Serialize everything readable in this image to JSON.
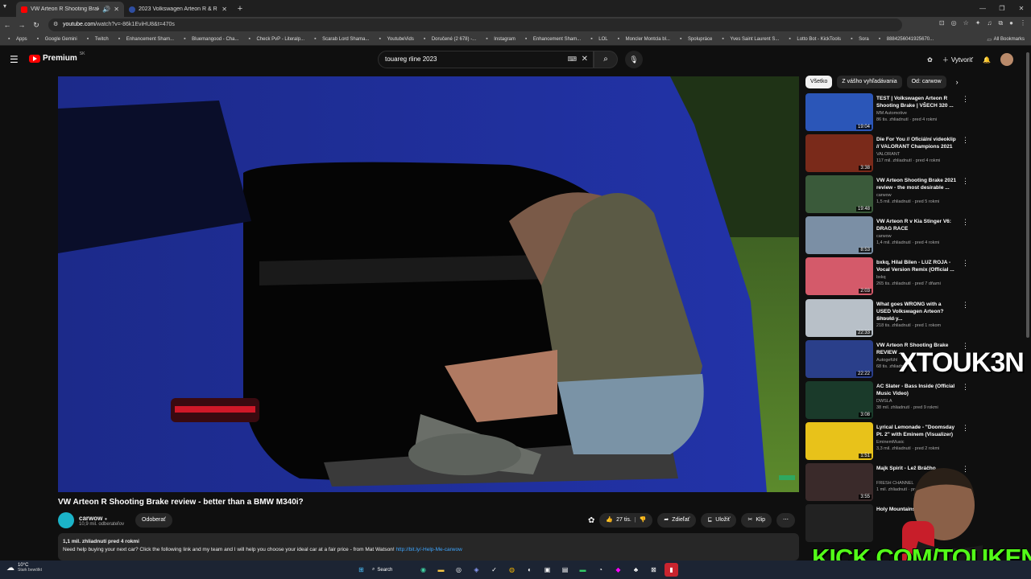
{
  "browser": {
    "tabs": [
      {
        "title": "VW Arteon R Shooting Brak",
        "active": true
      },
      {
        "title": "2023 Volkswagen Arteon R & R",
        "active": false
      }
    ],
    "url_prefix": "youtube.com",
    "url_rest": "/watch?v=-86k1EviHU8&t=470s",
    "bookmarks": [
      "Apps",
      "Google Gemini",
      "Twitch",
      "Enhancement Sham...",
      "Bluemangood - Cha...",
      "Check PvP - Literalp...",
      "Scarab Lord Shama...",
      "YoutubeVids",
      "Doručené (2 678) -...",
      "Instagram",
      "Enhancement Sham...",
      "LOL",
      "Moncler Montcla bl...",
      "Spolupráce",
      "Yves Saint Laurent S...",
      "Lotto Bot - KickTools",
      "Sora",
      "8884256041925670..."
    ],
    "all_bookmarks": "All Bookmarks"
  },
  "youtube": {
    "logo": "Premium",
    "logo_sup": "SK",
    "search_value": "touareg rline 2023",
    "create_label": "Vytvoriť",
    "video_title": "VW Arteon R Shooting Brake review - better than a BMW M340i?",
    "channel_name": "carwow",
    "channel_subs": "10,9 mil. odberateľov",
    "subscribe_label": "Odoberať",
    "likes": "27 tis.",
    "share_label": "Zdieľať",
    "save_label": "Uložiť",
    "clip_label": "Klip",
    "desc_meta": "1,1 mil. zhliadnutí  pred 4 rokmi",
    "desc_text": "Need help buying your next car? Click the following link and my team and I will help you choose your ideal car at a fair price - from Mat Watson! ",
    "desc_link": "http://bit.ly/-Help-Me-carwow",
    "chips": [
      "Všetko",
      "Z vášho vyhľadávania",
      "Od: carwow"
    ],
    "recs": [
      {
        "title": "TEST | Volkswagen Arteon R Shooting Brake |  VŠECH 320 ...",
        "channel": "MM Automotive",
        "views": "86 tis. zhliadnutí · pred 4 rokmi",
        "duration": "19:04",
        "thumb_color": "#2b56b8"
      },
      {
        "title": "Die For You // Oficiální videoklip // VALORANT Champions 2021",
        "channel": "VALORANT",
        "views": "117 mil. zhliadnutí · pred 4 rokmi",
        "duration": "3:38",
        "thumb_color": "#7a2a1a"
      },
      {
        "title": "VW Arteon Shooting Brake 2021 review - the most desirable ...",
        "channel": "carwow",
        "views": "1,5 mil. zhliadnutí · pred 5 rokmi",
        "duration": "19:48",
        "thumb_color": "#3a5a3a"
      },
      {
        "title": "VW Arteon R v Kia Stinger V6: DRAG RACE",
        "channel": "carwow",
        "views": "1,4 mil. zhliadnutí · pred 4 rokmi",
        "duration": "8:53",
        "thumb_color": "#7b8fa5"
      },
      {
        "title": "bxkq, Hilal Bilen - LUZ ROJA - Vocal Version Remix (Official ...",
        "channel": "bxkq",
        "views": "265 tis. zhliadnutí · pred 7 dňami",
        "duration": "2:03",
        "thumb_color": "#d45a6a"
      },
      {
        "title": "What goes WRONG with a USED Volkswagen Arteon? Should y...",
        "channel": "ReDriven",
        "views": "218 tis. zhliadnutí · pred 1 rokom",
        "duration": "22:33",
        "thumb_color": "#b8c0c8"
      },
      {
        "title": "VW Arteon R Shooting Brake REVIEW ...",
        "channel": "Autogefühl",
        "views": "68 tis. zhliadnutí",
        "duration": "22:22",
        "thumb_color": "#2a3f8a"
      },
      {
        "title": "AC Slater - Bass Inside (Official Music Video)",
        "channel": "DWSLA",
        "views": "38 mil. zhliadnutí · pred 9 rokmi",
        "duration": "3:08",
        "thumb_color": "#1a3a2a"
      },
      {
        "title": "Lyrical Lemonade - \"Doomsday Pt. 2\" with Eminem (Visualizer)",
        "channel": "EminemMusic",
        "views": "3,3 mil. zhliadnutí · pred 2 rokmi",
        "duration": "1:51",
        "thumb_color": "#e8c21a"
      },
      {
        "title": "Majk Spirit - Lež Bráčho",
        "channel": "FRESH CHANNEL",
        "views": "1 mil. zhliadnutí · pred",
        "duration": "3:55",
        "thumb_color": "#3a2a2a"
      },
      {
        "title": "Holy Mountains",
        "channel": "",
        "views": "",
        "duration": "",
        "thumb_color": "#222"
      }
    ]
  },
  "overlay": {
    "watermark": "XTOUK3N",
    "kick": "KICK.COM/TOUKEN"
  },
  "taskbar": {
    "temp": "10°C",
    "condition": "Stark bewölkt",
    "search": "Search"
  },
  "colors": {
    "accent": "#ff0000",
    "link": "#3ea6ff",
    "kick": "#53fc18"
  }
}
